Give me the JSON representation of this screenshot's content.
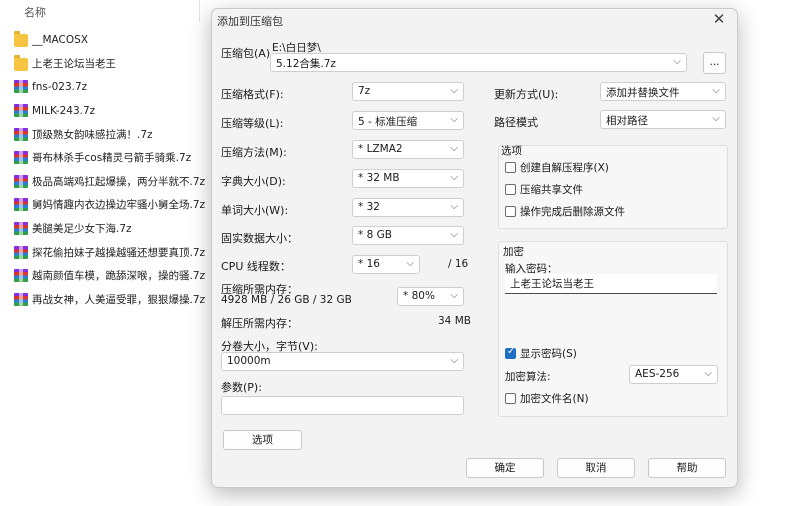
{
  "explorer": {
    "column_name": "名称",
    "files": [
      {
        "name": "__MACOSX",
        "type": "folder"
      },
      {
        "name": "上老王论坛当老王",
        "type": "folder"
      },
      {
        "name": "fns-023.7z",
        "type": "archive"
      },
      {
        "name": "MILK-243.7z",
        "type": "archive"
      },
      {
        "name": "顶级熟女韵味感拉满！.7z",
        "type": "archive"
      },
      {
        "name": "哥布林杀手cos精灵弓箭手骑乘.7z",
        "type": "archive"
      },
      {
        "name": "极品高端鸡扛起爆操，两分半就不.7z",
        "type": "archive"
      },
      {
        "name": "舅妈情趣内衣边操边牢骚小舅全场.7z",
        "type": "archive"
      },
      {
        "name": "美腿美足少女下海.7z",
        "type": "archive"
      },
      {
        "name": "探花偷拍妹子越操越骚还想要真顶.7z",
        "type": "archive"
      },
      {
        "name": "越南颜值车模，跪舔深喉，操的骚.7z",
        "type": "archive"
      },
      {
        "name": "再战女神，人美逼受罪，狠狠爆操.7z",
        "type": "archive"
      }
    ]
  },
  "dialog": {
    "title": "添加到压缩包",
    "archive_label": "压缩包(A)",
    "archive_path": "E:\\白日梦\\",
    "archive_name": "5.12合集.7z",
    "browse_label": "...",
    "format_label": "压缩格式(F):",
    "format_value": "7z",
    "level_label": "压缩等级(L):",
    "level_value": "5 - 标准压缩",
    "method_label": "压缩方法(M):",
    "method_value": "* LZMA2",
    "dict_label": "字典大小(D):",
    "dict_value": "* 32 MB",
    "word_label": "单词大小(W):",
    "word_value": "* 32",
    "solid_label": "固实数据大小：",
    "solid_value": "* 8 GB",
    "cpu_label": "CPU 线程数：",
    "cpu_value": "* 16",
    "cpu_total": "/ 16",
    "mem_label": "压缩所需内存：",
    "mem_detail": "4928 MB / 26 GB / 32 GB",
    "mem_value": "* 80%",
    "decomp_label": "解压所需内存：",
    "decomp_value": "34 MB",
    "split_label": "分卷大小，字节(V):",
    "split_value": "10000m",
    "params_label": "参数(P):",
    "params_value": "",
    "options_button": "选项",
    "update_label": "更新方式(U):",
    "update_value": "添加并替换文件",
    "pathmode_label": "路径模式",
    "pathmode_value": "相对路径",
    "options_group": "选项",
    "opt_sfx": "创建自解压程序(X)",
    "opt_shared": "压缩共享文件",
    "opt_delete": "操作完成后删除源文件",
    "encrypt_group": "加密",
    "password_label": "输入密码：",
    "password_value": "上老王论坛当老王",
    "show_password": "显示密码(S)",
    "show_password_checked": true,
    "enc_method_label": "加密算法:",
    "enc_method_value": "AES-256",
    "enc_names": "加密文件名(N)",
    "ok": "确定",
    "cancel": "取消",
    "help": "帮助"
  },
  "colors": {
    "accent": "#1f6fc5",
    "dialog_bg": "#f3f3f3"
  }
}
